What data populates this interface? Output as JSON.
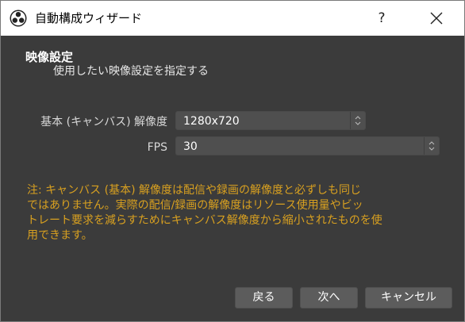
{
  "window": {
    "title": "自動構成ウィザード",
    "help_label": "?",
    "close_icon": "close-icon"
  },
  "page": {
    "title": "映像設定",
    "subtitle": "使用したい映像設定を指定する"
  },
  "fields": {
    "base_resolution": {
      "label": "基本 (キャンバス) 解像度",
      "value": "1280x720"
    },
    "fps": {
      "label": "FPS",
      "value": "30"
    }
  },
  "note": {
    "line1": "注: キャンバス (基本) 解像度は配信や録画の解像度と必ずしも同じ",
    "line2": "ではありません。実際の配信/録画の解像度はリソース使用量やビッ",
    "line3": "トレート要求を減らすためにキャンバス解像度から縮小されたものを使",
    "line4": "用できます。"
  },
  "buttons": {
    "back": "戻る",
    "next": "次へ",
    "cancel": "キャンセル"
  },
  "colors": {
    "background": "#3b3b3b",
    "note_text": "#d8a020",
    "titlebar": "#ffffff"
  }
}
